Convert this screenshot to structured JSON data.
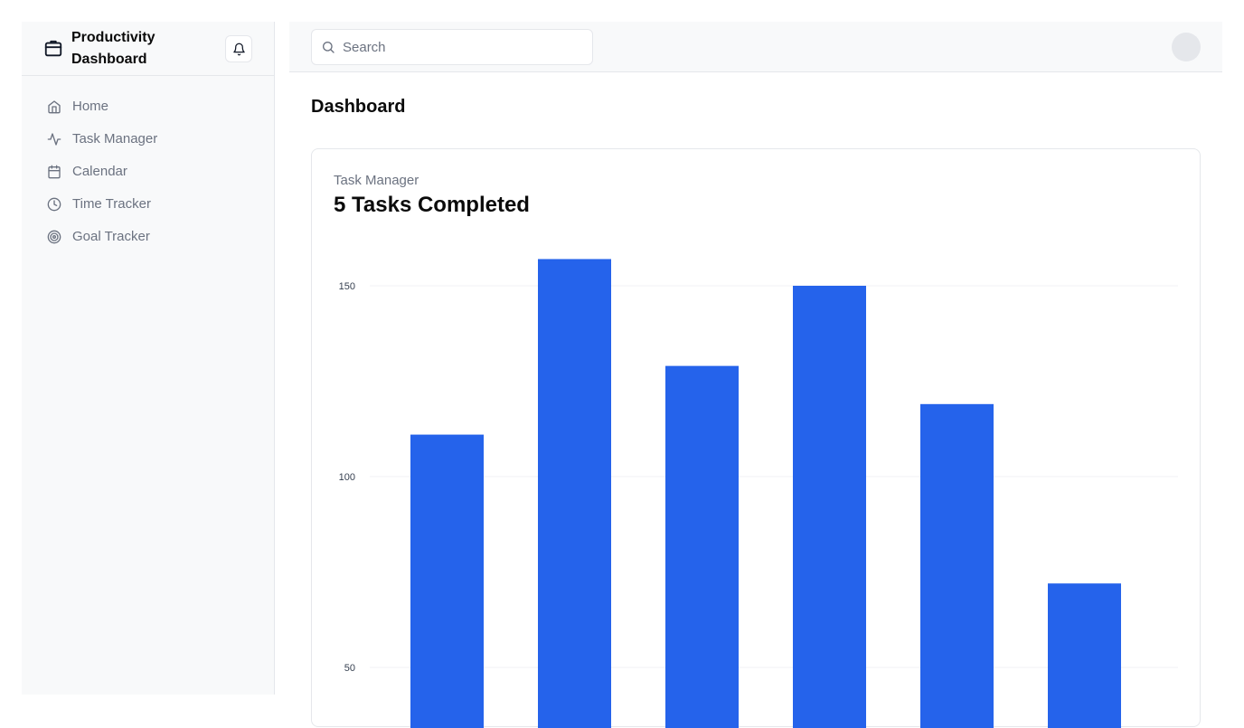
{
  "sidebar": {
    "brand_title": "Productivity Dashboard",
    "items": [
      {
        "label": "Home",
        "icon": "home-icon"
      },
      {
        "label": "Task Manager",
        "icon": "activity-icon"
      },
      {
        "label": "Calendar",
        "icon": "calendar-icon"
      },
      {
        "label": "Time Tracker",
        "icon": "clock-icon"
      },
      {
        "label": "Goal Tracker",
        "icon": "target-icon"
      }
    ]
  },
  "topbar": {
    "search_placeholder": "Search"
  },
  "main": {
    "page_title": "Dashboard",
    "card": {
      "label": "Task Manager",
      "title": "5 Tasks Completed"
    }
  },
  "colors": {
    "bar": "#2563eb",
    "sidebar_bg": "#f8f9fa",
    "border": "#e5e7eb",
    "muted_text": "#6b7280"
  },
  "chart_data": {
    "type": "bar",
    "values": [
      111,
      157,
      129,
      150,
      119,
      72
    ],
    "yticks": [
      50,
      100,
      150
    ],
    "ylim": [
      50,
      165
    ],
    "grid": true
  }
}
